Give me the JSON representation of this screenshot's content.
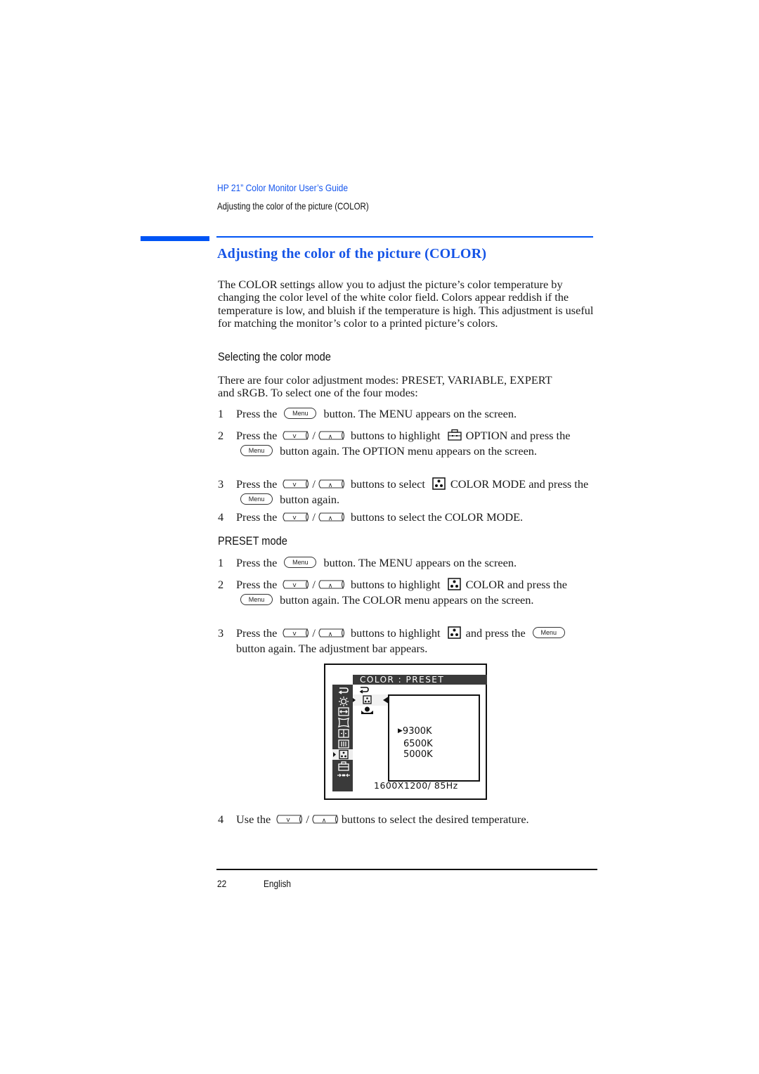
{
  "header": {
    "guide_title": "HP 21” Color Monitor User’s Guide",
    "section_subtitle": "Adjusting the color of the picture (COLOR)"
  },
  "page_title": "Adjusting the color of the picture (COLOR)",
  "intro": "The COLOR settings allow you to adjust the picture’s color temperature by changing the color level of the white color field. Colors appear reddish if the temperature is low, and bluish if the temperature is high. This adjustment is useful for matching the monitor’s color to a printed picture’s colors.",
  "section1": {
    "heading": "Selecting the color mode",
    "intro": "There are four color adjustment modes: PRESET, VARIABLE, EXPERT and sRGB. To select one of the four modes:",
    "steps": [
      {
        "num": "1",
        "a": "Press the",
        "b": "button. The MENU appears on the screen."
      },
      {
        "num": "2",
        "a": "Press the",
        "sep": "/",
        "b": "buttons to highlight",
        "c": "OPTION and",
        "d": "press the",
        "e": "button again. The OPTION menu appears on the screen."
      },
      {
        "num": "3",
        "a": "Press the",
        "sep": "/",
        "b": "buttons to select",
        "c": "COLOR MODE",
        "d": "and press the",
        "e": "button again."
      },
      {
        "num": "4",
        "a": "Press the",
        "sep": "/",
        "b": "buttons to select the COLOR MODE."
      }
    ]
  },
  "section2": {
    "heading": "PRESET mode",
    "steps": [
      {
        "num": "1",
        "a": "Press the",
        "b": "button. The MENU appears on the screen."
      },
      {
        "num": "2",
        "a": "Press the",
        "sep": "/",
        "b": "buttons to highlight",
        "c": "COLOR and",
        "d": "press the",
        "e": "button again. The COLOR menu appears on the screen."
      },
      {
        "num": "3",
        "a": "Press the",
        "sep": "/",
        "b": "buttons to highlight",
        "c": "and press the",
        "e": "button again. The adjustment bar appears."
      },
      {
        "num": "4",
        "a": "Use the",
        "sep": "/",
        "b": "buttons to select the desired temperature."
      }
    ]
  },
  "keys": {
    "menu": "Menu",
    "down": "v",
    "up": "^"
  },
  "osd": {
    "title": "COLOR  :  PRESET",
    "options": [
      "9300K",
      "6500K",
      "5000K"
    ],
    "selected_option": "9300K",
    "resolution": "1600X1200/  85Hz",
    "sidebar_icons": [
      "return-icon",
      "brightness-icon",
      "size-icon",
      "geometry-icon",
      "convergence-icon",
      "moire-icon",
      "color-icon",
      "option-icon",
      "degauss-icon"
    ],
    "sidebar_selected": "color-icon",
    "submenu_icons": [
      "return-icon",
      "color-mode-icon",
      "user-color-icon"
    ],
    "submenu_selected": "color-mode-icon"
  },
  "footer": {
    "page_number": "22",
    "language": "English"
  },
  "colors": {
    "accent_blue": "#0054f5",
    "title_blue": "#1453e6",
    "osd_dark": "#3a3a3a"
  }
}
